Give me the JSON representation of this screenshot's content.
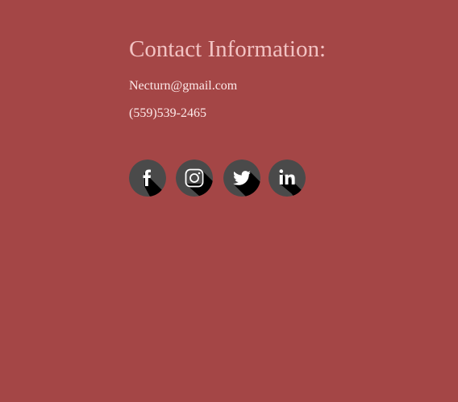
{
  "contact": {
    "title": "Contact Information:",
    "email": "Necturn@gmail.com",
    "phone": "(559)539-2465"
  },
  "socials": [
    {
      "icon": "facebook-icon"
    },
    {
      "icon": "instagram-icon"
    },
    {
      "icon": "twitter-icon"
    },
    {
      "icon": "linkedin-icon"
    }
  ],
  "colors": {
    "background": "#a44646",
    "title": "#f2c3c3",
    "text": "#fde9e9",
    "icon_circle": "#4a4a4a",
    "icon_shadow": "#000000",
    "icon_glyph": "#ffffff"
  }
}
